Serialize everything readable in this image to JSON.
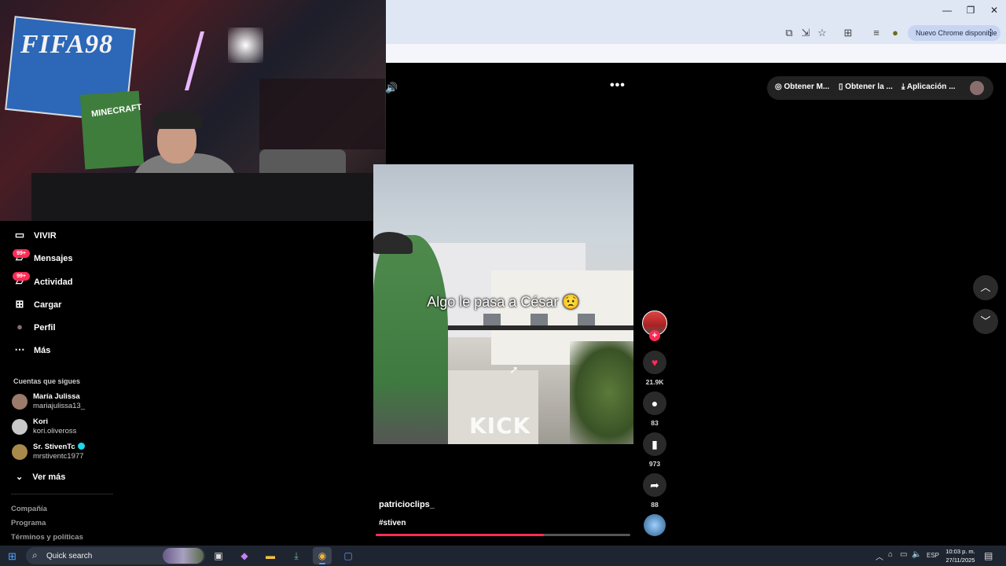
{
  "browser": {
    "update_label": "Nuevo Chrome disponible",
    "window_controls": {
      "minimize": "—",
      "restore": "❐",
      "close": "✕"
    },
    "toolbar_icons": [
      "translate-icon",
      "cast-icon",
      "star-icon",
      "extensions-icon",
      "reading-list-icon",
      "profile-icon"
    ]
  },
  "header": {
    "items": [
      {
        "label": "Obtener M...",
        "icon": "coin-icon"
      },
      {
        "label": "Obtener la ...",
        "icon": "phone-icon"
      },
      {
        "label": "Aplicación ...",
        "icon": "download-icon"
      }
    ]
  },
  "sidebar": {
    "items": [
      {
        "label": "VIVIR",
        "icon": "live-icon"
      },
      {
        "label": "Mensajes",
        "icon": "messages-icon",
        "badge": "99+"
      },
      {
        "label": "Actividad",
        "icon": "activity-icon",
        "badge": "99+"
      },
      {
        "label": "Cargar",
        "icon": "upload-icon"
      },
      {
        "label": "Perfil",
        "icon": "profile-icon"
      },
      {
        "label": "Más",
        "icon": "more-icon"
      }
    ],
    "following_title": "Cuentas que sigues",
    "following": [
      {
        "name": "María Julissa",
        "handle": "mariajulissa13_",
        "avatar_color": "#9b7b6b"
      },
      {
        "name": "Kori",
        "handle": "kori.oliveross",
        "avatar_color": "#c8c8c8"
      },
      {
        "name": "Sr. StivenTc",
        "handle": "mrstiventc1977",
        "avatar_color": "#a88a4a",
        "verified": true
      }
    ],
    "see_more": "Ver más",
    "footer": [
      "Compañía",
      "Programa",
      "Términos y políticas"
    ]
  },
  "video": {
    "caption": "Algo le pasa a César 😟",
    "watermark": "KICK",
    "author": "patricioclips_",
    "hashtag": "#stiven",
    "progress": 0.66
  },
  "actions": {
    "likes": "21.9K",
    "comments": "83",
    "saves": "973",
    "shares": "88"
  },
  "webcam": {
    "poster_text": "FIFA98",
    "mine_text": "MINECRAFT"
  },
  "taskbar": {
    "search_placeholder": "Quick search",
    "language": "ESP",
    "time": "10:03 p. m.",
    "date": "27/11/2025"
  },
  "colors": {
    "accent": "#fe2c55",
    "background": "#000000",
    "chrome_frame": "#dfe7f5"
  }
}
